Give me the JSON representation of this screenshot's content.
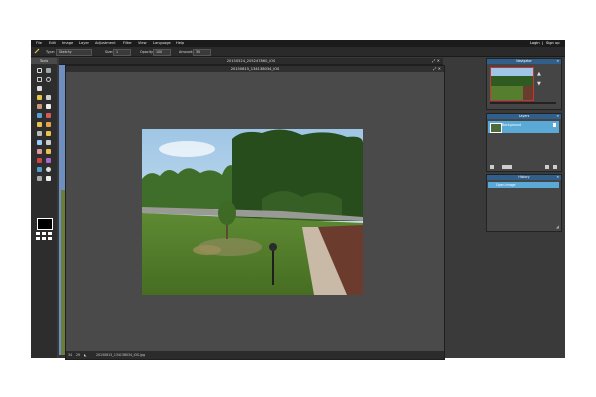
{
  "menu": {
    "items": [
      "File",
      "Edit",
      "Image",
      "Layer",
      "Adjustment",
      "Filter",
      "View",
      "Language",
      "Help"
    ],
    "login": "Login",
    "separator": "|",
    "signup": "Sign up"
  },
  "options": {
    "type_label": "Type:",
    "type_value": "Sketchy",
    "size_label": "Size:",
    "size_value": "1",
    "opacity_label": "Opacity:",
    "opacity_value": "100",
    "amount_label": "Amount:",
    "amount_value": "30"
  },
  "tools": {
    "title": "Tools"
  },
  "documents": {
    "back_title": "20150524_205247860_iOS",
    "front_title": "20150615_134138034_iOS",
    "zoom": "34",
    "extra": "29",
    "status_file": "20150615_134138034_iOS.jpg"
  },
  "navigator": {
    "title": "Navigator"
  },
  "layers": {
    "title": "Layers",
    "items": [
      {
        "name": "Background"
      }
    ]
  },
  "history": {
    "title": "History",
    "items": [
      {
        "name": "Open Image"
      }
    ]
  }
}
